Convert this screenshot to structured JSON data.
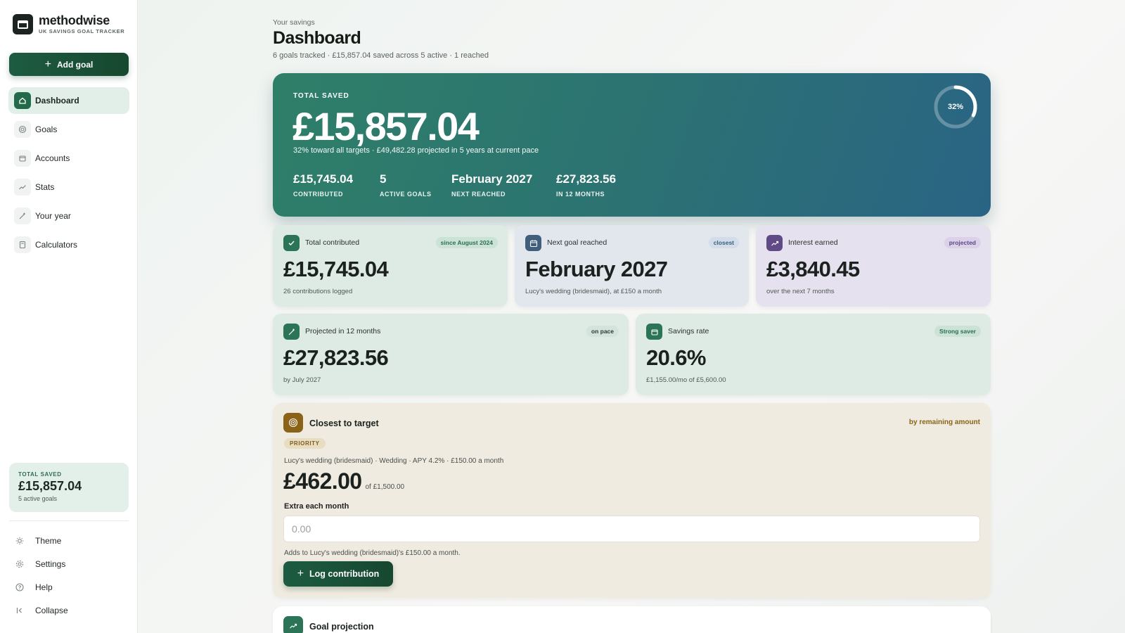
{
  "brand": {
    "name": "methodwise",
    "tagline": "UK SAVINGS GOAL TRACKER"
  },
  "sidebar": {
    "add_goal_label": "Add goal",
    "items": [
      {
        "label": "Dashboard",
        "icon": "home-icon",
        "active": true
      },
      {
        "label": "Goals",
        "icon": "target-icon"
      },
      {
        "label": "Accounts",
        "icon": "wallet-icon"
      },
      {
        "label": "Stats",
        "icon": "trend-icon"
      },
      {
        "label": "Your year",
        "icon": "sparkle-icon"
      },
      {
        "label": "Calculators",
        "icon": "calculator-icon"
      }
    ],
    "total": {
      "label": "TOTAL SAVED",
      "value": "£15,857.04",
      "sub": "5 active goals"
    },
    "bottom": [
      {
        "label": "Theme",
        "icon": "sun-icon"
      },
      {
        "label": "Settings",
        "icon": "gear-icon"
      },
      {
        "label": "Help",
        "icon": "help-icon"
      },
      {
        "label": "Collapse",
        "icon": "collapse-icon"
      }
    ]
  },
  "header": {
    "crumb": "Your savings",
    "title": "Dashboard",
    "subtitle": "6 goals tracked · £15,857.04 saved across 5 active · 1 reached"
  },
  "hero": {
    "label": "TOTAL SAVED",
    "value": "£15,857.04",
    "sub": "32% toward all targets · £49,482.28 projected in 5 years at current pace",
    "progress_percent": 32,
    "progress_label": "32%",
    "stats": [
      {
        "value": "£15,745.04",
        "label": "CONTRIBUTED"
      },
      {
        "value": "5",
        "label": "ACTIVE GOALS"
      },
      {
        "value": "February 2027",
        "label": "NEXT REACHED"
      },
      {
        "value": "£27,823.56",
        "label": "IN 12 MONTHS"
      }
    ]
  },
  "cards": {
    "contributed": {
      "title": "Total contributed",
      "badge": "since August 2024",
      "value": "£15,745.04",
      "sub": "26 contributions logged"
    },
    "next_goal": {
      "title": "Next goal reached",
      "badge": "closest",
      "value": "February 2027",
      "sub": "Lucy's wedding (bridesmaid), at £150 a month"
    },
    "interest": {
      "title": "Interest earned",
      "badge": "projected",
      "value": "£3,840.45",
      "sub": "over the next 7 months"
    },
    "projected": {
      "title": "Projected in 12 months",
      "badge": "on pace",
      "value": "£27,823.56",
      "sub": "by July 2027"
    },
    "rate": {
      "title": "Savings rate",
      "badge": "Strong saver",
      "value": "20.6%",
      "sub": "£1,155.00/mo of £5,600.00"
    }
  },
  "priority": {
    "title": "Closest to target",
    "right_label": "by remaining amount",
    "tag": "PRIORITY",
    "meta": "Lucy's wedding (bridesmaid) · Wedding · APY 4.2% · £150.00 a month",
    "amount": "£462.00",
    "of_amount": "of £1,500.00",
    "input_label": "Extra each month",
    "input_placeholder": "0.00",
    "help": "Adds to Lucy's wedding (bridesmaid)'s £150.00 a month.",
    "button_label": "Log contribution"
  },
  "projection": {
    "title": "Goal projection"
  }
}
